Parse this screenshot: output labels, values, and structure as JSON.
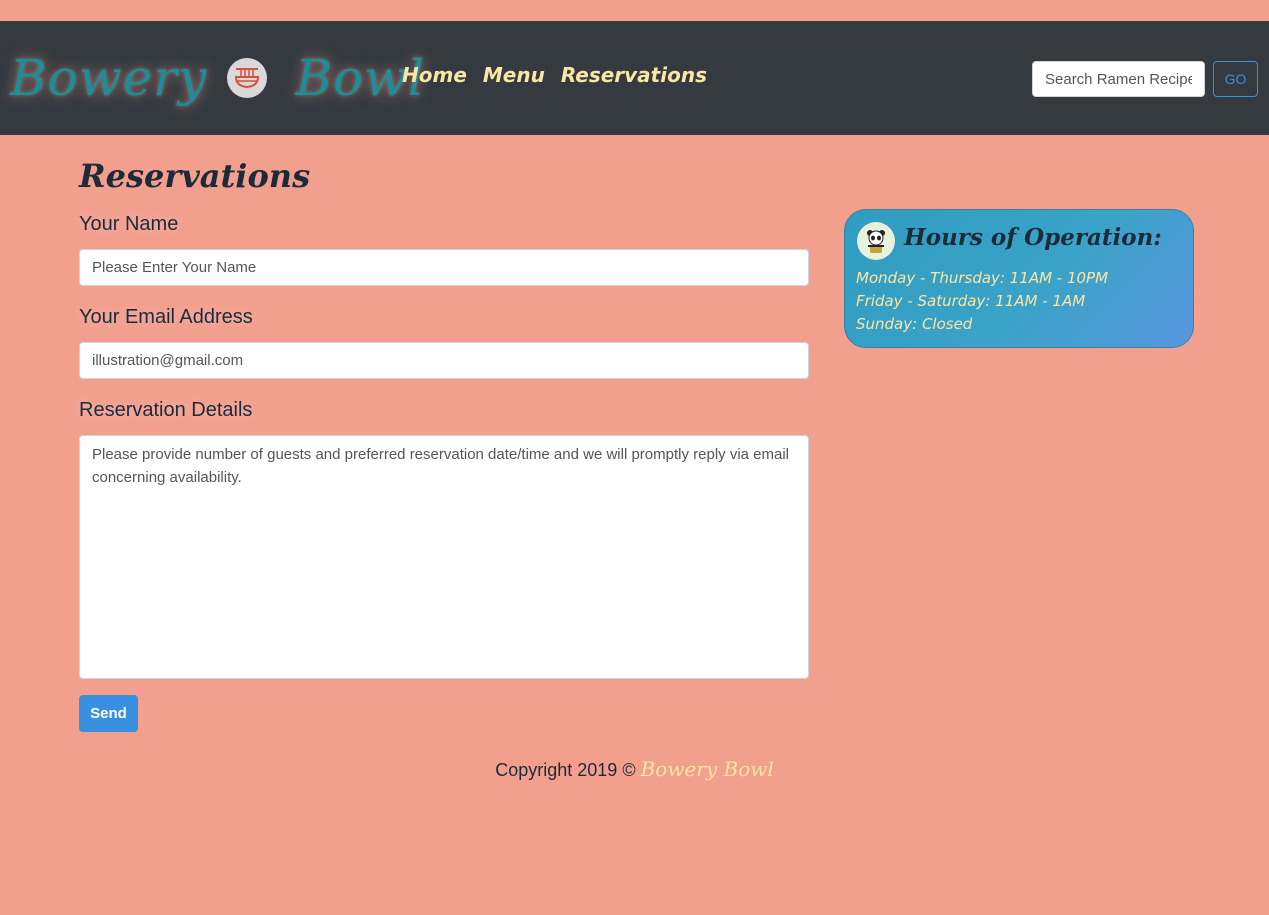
{
  "header": {
    "brand_left": "Bowery",
    "brand_right": "Bowl",
    "nav": [
      "Home",
      "Menu",
      "Reservations"
    ],
    "search_placeholder": "Search Ramen Recipes",
    "go_label": "GO"
  },
  "main": {
    "title": "Reservations",
    "name_label": "Your Name",
    "name_placeholder": "Please Enter Your Name",
    "email_label": "Your Email Address",
    "email_placeholder": "illustration@gmail.com",
    "details_label": "Reservation Details",
    "details_placeholder": "Please provide number of guests and preferred reservation date/time and we will promptly reply via email concerning availability.",
    "send_label": "Send"
  },
  "hours": {
    "title": "Hours of Operation:",
    "lines": [
      "Monday - Thursday: 11AM - 10PM",
      "Friday - Saturday: 11AM - 1AM",
      "Sunday: Closed"
    ]
  },
  "footer": {
    "copyright": "Copyright 2019 ©",
    "brand": "Bowery Bowl"
  },
  "colors": {
    "page_bg": "#f29f8e",
    "nav_bg": "#343a40",
    "brand_teal": "#1a8e9a",
    "accent_yellow": "#fbe6a4",
    "button_blue": "#3890e3"
  },
  "icons": [
    "ramen-bowl-icon",
    "panda-icon"
  ]
}
